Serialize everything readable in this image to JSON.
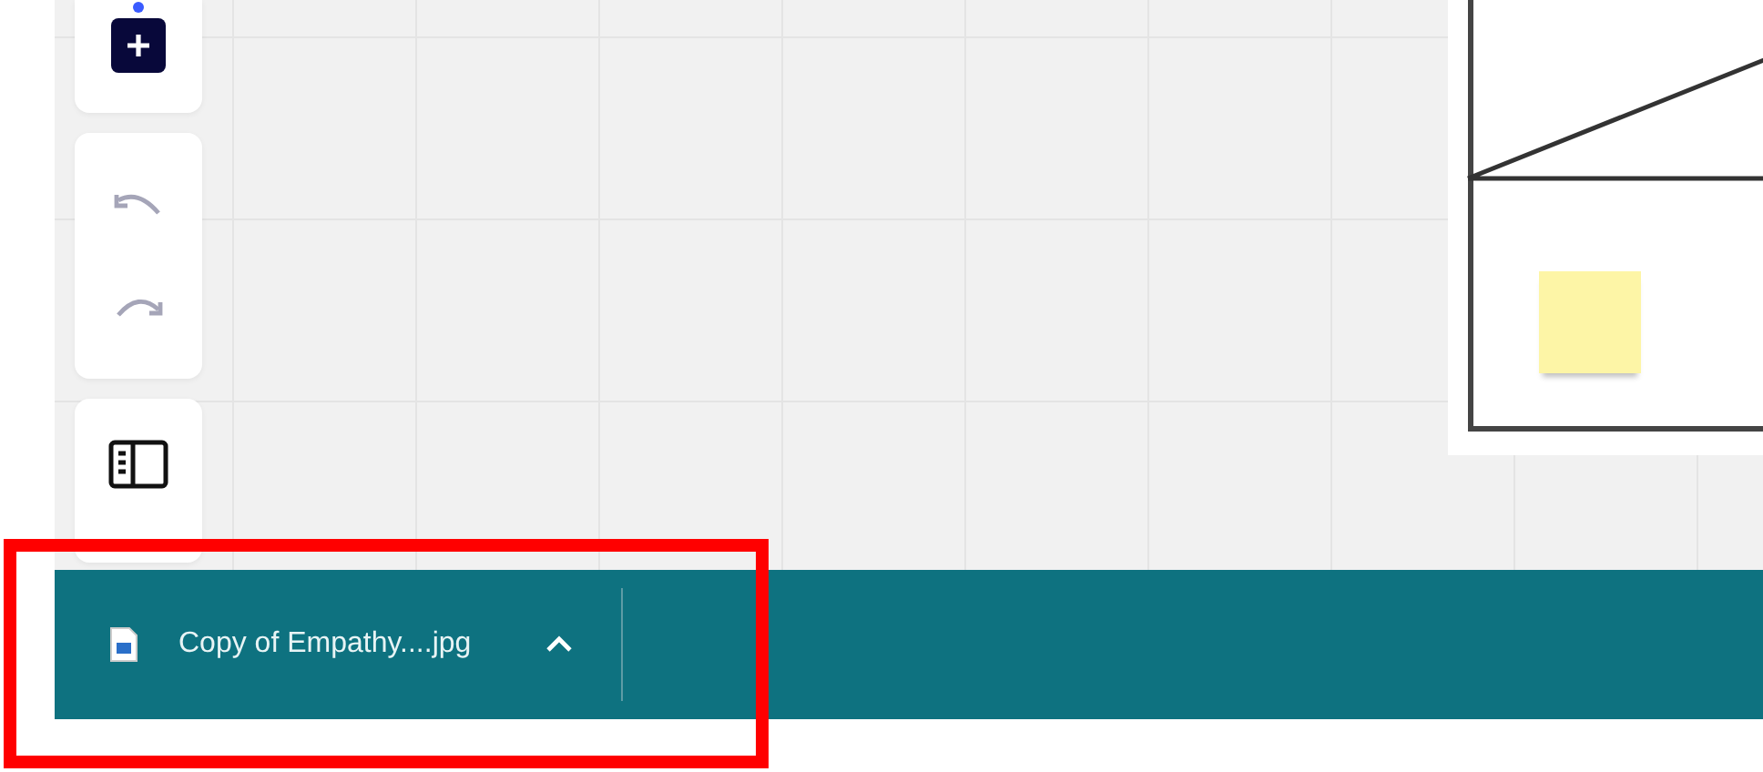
{
  "download_bar": {
    "items": [
      {
        "filename": "Copy of Empathy....jpg"
      }
    ]
  }
}
